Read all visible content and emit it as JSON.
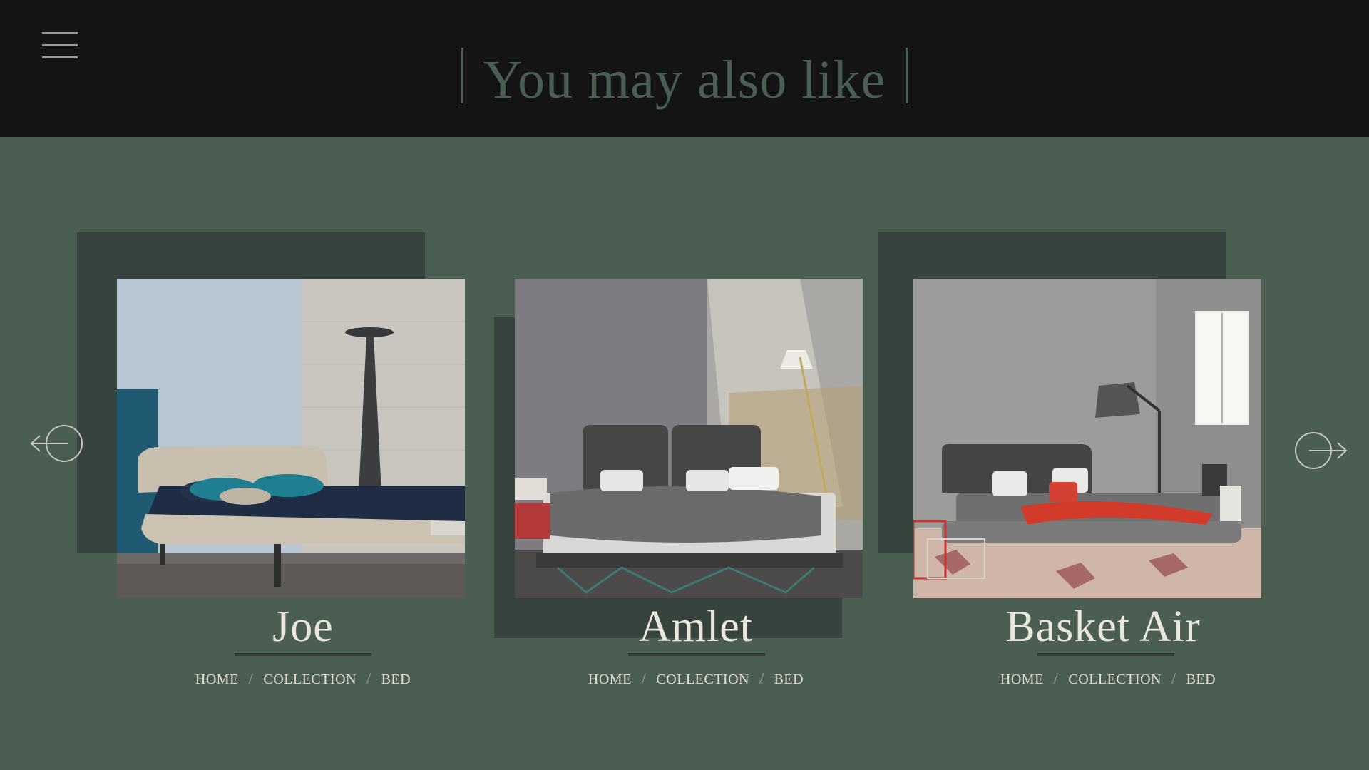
{
  "header": {
    "title": "You may also like",
    "menu_icon": "hamburger-menu-icon"
  },
  "colors": {
    "page_background": "#4b5e52",
    "header_background": "#141414",
    "title_color": "#4a5f53",
    "backplate": "#37443d",
    "text_light": "#eae6de"
  },
  "carousel": {
    "prev_icon": "arrow-left-circle-icon",
    "next_icon": "arrow-right-circle-icon",
    "products": [
      {
        "name": "Joe",
        "breadcrumb": [
          "HOME",
          "COLLECTION",
          "BED"
        ],
        "image": "bed-joe-photo"
      },
      {
        "name": "Amlet",
        "breadcrumb": [
          "HOME",
          "COLLECTION",
          "BED"
        ],
        "image": "bed-amlet-photo"
      },
      {
        "name": "Basket Air",
        "breadcrumb": [
          "HOME",
          "COLLECTION",
          "BED"
        ],
        "image": "bed-basket-air-photo"
      }
    ]
  }
}
